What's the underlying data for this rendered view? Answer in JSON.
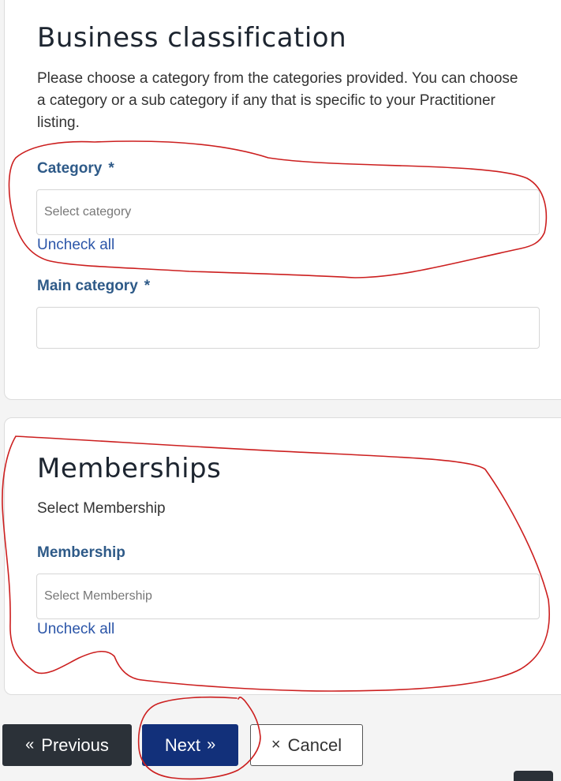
{
  "business": {
    "title": "Business classification",
    "description": "Please choose a category from the categories provided. You can choose a category or a sub category if any that is specific to your Practitioner listing.",
    "category": {
      "label": "Category",
      "required_mark": "*",
      "placeholder": "Select category",
      "uncheck_label": "Uncheck all"
    },
    "main_category": {
      "label": "Main category",
      "required_mark": "*",
      "value": ""
    }
  },
  "memberships": {
    "title": "Memberships",
    "description": "Select Membership",
    "membership": {
      "label": "Membership",
      "placeholder": "Select Membership",
      "uncheck_label": "Uncheck all"
    }
  },
  "nav": {
    "previous_label": "Previous",
    "next_label": "Next",
    "cancel_label": "Cancel",
    "previous_icon": "double-chevron-left-icon",
    "next_icon": "double-chevron-right-icon",
    "cancel_icon": "close-icon"
  },
  "colors": {
    "label_blue": "#2e5a88",
    "link_blue": "#2b55a8",
    "next_button": "#12307a",
    "previous_button": "#2b3138",
    "annotation_red": "#cc1f1f"
  }
}
